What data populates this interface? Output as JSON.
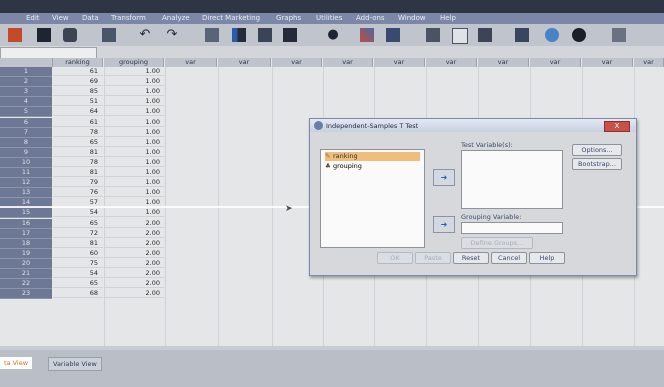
{
  "menu": [
    "Edit",
    "View",
    "Data",
    "Transform",
    "Analyze",
    "Direct Marketing",
    "Graphs",
    "Utilities",
    "Add-ons",
    "Window",
    "Help"
  ],
  "toolbar_icons": [
    "open-icon",
    "save-icon",
    "print-icon",
    "dialog-recall-icon",
    "undo-icon",
    "redo-icon",
    "goto-case-icon",
    "goto-variable-icon",
    "variables-icon",
    "insert-cases-icon",
    "find-icon",
    "split-file-icon",
    "weight-cases-icon",
    "value-labels-icon",
    "select-cases-icon",
    "use-sets-icon",
    "scale-icon",
    "spelling-icon",
    "chart-icon",
    "custom-icon"
  ],
  "grid": {
    "columns": [
      "ranking",
      "grouping",
      "var",
      "var",
      "var",
      "var",
      "var",
      "var",
      "var",
      "var",
      "var",
      "var"
    ],
    "rows": [
      {
        "n": "1",
        "ranking": "61",
        "grouping": "1.00"
      },
      {
        "n": "2",
        "ranking": "69",
        "grouping": "1.00"
      },
      {
        "n": "3",
        "ranking": "85",
        "grouping": "1.00"
      },
      {
        "n": "4",
        "ranking": "51",
        "grouping": "1.00"
      },
      {
        "n": "5",
        "ranking": "64",
        "grouping": "1.00"
      },
      {
        "n": "6",
        "ranking": "61",
        "grouping": "1.00"
      },
      {
        "n": "7",
        "ranking": "78",
        "grouping": "1.00"
      },
      {
        "n": "8",
        "ranking": "65",
        "grouping": "1.00"
      },
      {
        "n": "9",
        "ranking": "81",
        "grouping": "1.00"
      },
      {
        "n": "10",
        "ranking": "78",
        "grouping": "1.00"
      },
      {
        "n": "11",
        "ranking": "81",
        "grouping": "1.00"
      },
      {
        "n": "12",
        "ranking": "79",
        "grouping": "1.00"
      },
      {
        "n": "13",
        "ranking": "76",
        "grouping": "1.00"
      },
      {
        "n": "14",
        "ranking": "57",
        "grouping": "1.00"
      },
      {
        "n": "15",
        "ranking": "54",
        "grouping": "1.00"
      },
      {
        "n": "16",
        "ranking": "65",
        "grouping": "2.00"
      },
      {
        "n": "17",
        "ranking": "72",
        "grouping": "2.00"
      },
      {
        "n": "18",
        "ranking": "81",
        "grouping": "2.00"
      },
      {
        "n": "19",
        "ranking": "60",
        "grouping": "2.00"
      },
      {
        "n": "20",
        "ranking": "75",
        "grouping": "2.00"
      },
      {
        "n": "21",
        "ranking": "54",
        "grouping": "2.00"
      },
      {
        "n": "22",
        "ranking": "65",
        "grouping": "2.00"
      },
      {
        "n": "23",
        "ranking": "68",
        "grouping": "2.00"
      }
    ]
  },
  "tabs": {
    "data_view": "ta View",
    "variable_view": "Variable View"
  },
  "dialog": {
    "title": "Independent-Samples T Test",
    "close": "X",
    "source_vars": [
      "ranking",
      "grouping"
    ],
    "test_variables_label": "Test Variable(s):",
    "grouping_variable_label": "Grouping Variable:",
    "define_groups": "Define Groups...",
    "options": "Options...",
    "bootstrap": "Bootstrap...",
    "ok": "OK",
    "paste": "Paste",
    "reset": "Reset",
    "cancel": "Cancel",
    "help": "Help"
  }
}
